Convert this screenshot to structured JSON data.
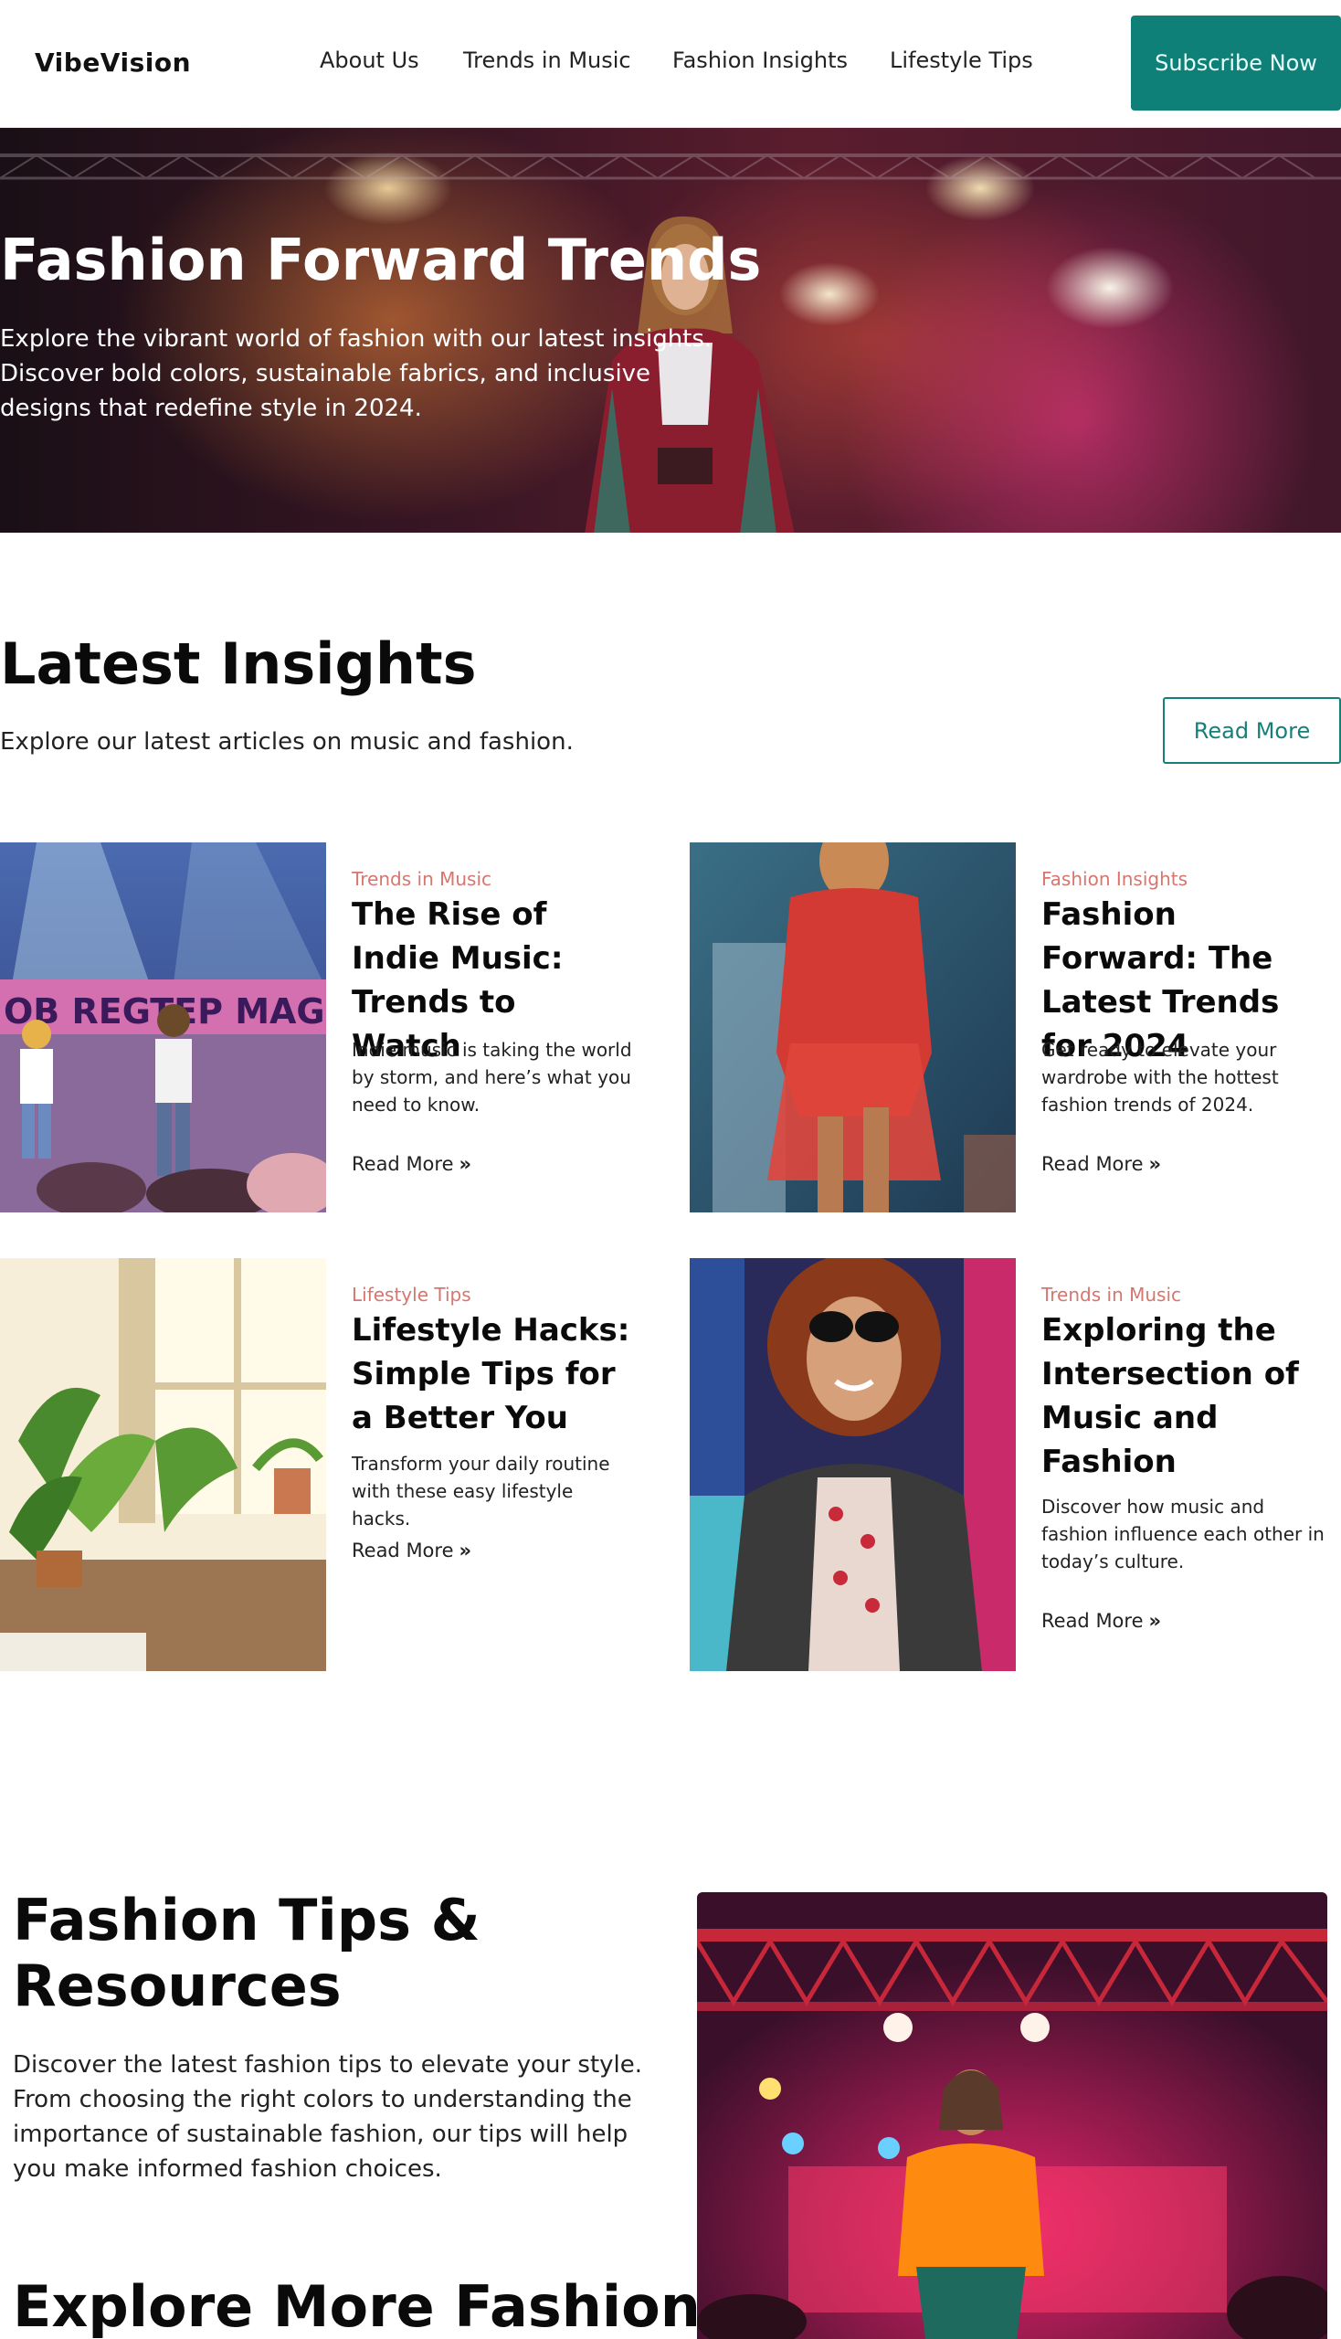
{
  "header": {
    "logo": "VibeVision",
    "nav": [
      "About Us",
      "Trends in Music",
      "Fashion Insights",
      "Lifestyle Tips"
    ],
    "subscribe_label": "Subscribe Now"
  },
  "hero": {
    "title": "Fashion Forward Trends",
    "text": "Explore the vibrant world of fashion with our latest insights. Discover bold colors, sustainable fabrics, and inclusive designs that redefine style in 2024."
  },
  "insights": {
    "title": "Latest Insights",
    "subtitle": "Explore our latest articles on music and fashion.",
    "read_more_label": "Read More",
    "cards": [
      {
        "category": "Trends in Music",
        "title": "The Rise of Indie Music: Trends to Watch",
        "description": "Indie music is taking the world by storm, and here’s what you need to know.",
        "link": "Read More",
        "image": "indie-concert-illustration"
      },
      {
        "category": "Fashion Insights",
        "title": "Fashion Forward: The Latest Trends for 2024",
        "description": "Get ready to elevate your wardrobe with the hottest fashion trends of 2024.",
        "link": "Read More",
        "image": "red-dress-runway-photo"
      },
      {
        "category": "Lifestyle Tips",
        "title": "Lifestyle Hacks: Simple Tips for a Better You",
        "description": "Transform your daily routine with these easy lifestyle hacks.",
        "link": "Read More",
        "image": "sunlit-room-plants-illustration"
      },
      {
        "category": "Trends in Music",
        "title": "Exploring the Intersection of Music and Fashion",
        "description": "Discover how music and fashion influence each other in today’s culture.",
        "link": "Read More",
        "image": "woman-sunglasses-photo"
      }
    ]
  },
  "tips": {
    "title": "Fashion Tips & Resources",
    "text": "Discover the latest fashion tips to elevate your style. From choosing the right colors to understanding the importance of sustainable fashion, our tips will help you make informed fashion choices.",
    "image": "orange-shirt-runway-photo"
  },
  "explore": {
    "title": "Explore More Fashion"
  },
  "colors": {
    "accent": "#0f8078",
    "category": "#d6766e"
  }
}
